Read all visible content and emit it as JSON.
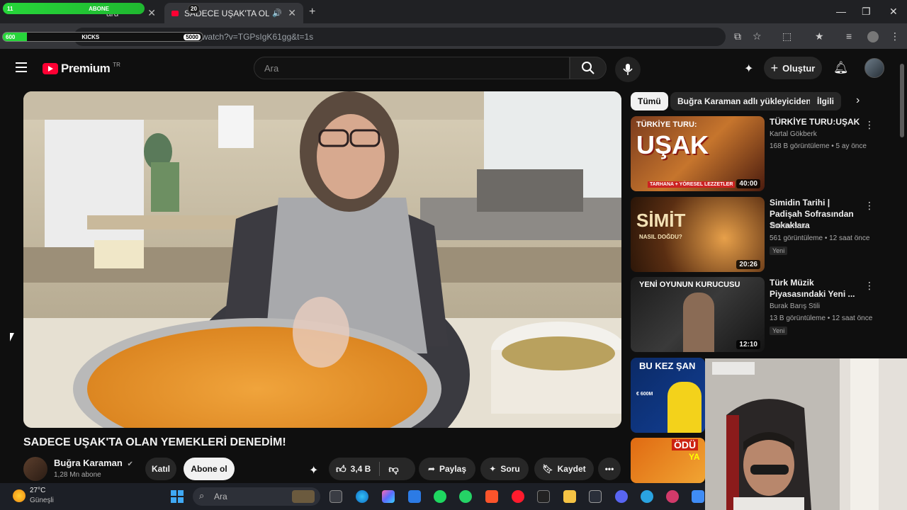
{
  "browser": {
    "tabs": [
      {
        "label": "ard"
      },
      {
        "label": "SADECE UŞAK'TA OLAN YE"
      }
    ],
    "overlay": {
      "left": "11",
      "center": "ABONE",
      "badge": "20"
    },
    "url": "https://www.youtube.com/watch?v=TGPsIgK61gg&t=1s",
    "overlay2": {
      "left": "600",
      "center": "KICKS",
      "right": "5000"
    }
  },
  "youtube": {
    "logo": "Premium",
    "region": "TR",
    "search_placeholder": "Ara",
    "create_label": "Oluştur"
  },
  "video": {
    "title": "SADECE UŞAK'TA OLAN YEMEKLERİ DENEDİM!",
    "channel": "Buğra Karaman",
    "subscribers": "1,28 Mn abone",
    "join_label": "Katıl",
    "subscribe_label": "Abone ol",
    "likes": "3,4 B",
    "share_label": "Paylaş",
    "ask_label": "Soru",
    "save_label": "Kaydet"
  },
  "chips": [
    "Tümü",
    "Buğra Karaman adlı yükleyiciden",
    "İlgili"
  ],
  "recommendations": [
    {
      "title": "TÜRKİYE TURU:UŞAK",
      "channel": "Kartal Gökberk",
      "meta": "168 B görüntüleme • 5 ay önce",
      "duration": "40:00",
      "badge": "",
      "thumb_text": "UŞAK",
      "thumb_top": "TÜRKİYE TURU:",
      "thumb_bottom": "TARHANA + YÖRESEL LEZZETLER"
    },
    {
      "title": "Simidin Tarihi | Padişah Sofrasından Sokaklara",
      "channel": "Tarihin Notu",
      "meta": "561 görüntüleme • 12 saat önce",
      "duration": "20:26",
      "badge": "Yeni",
      "thumb_text": "SİMİT",
      "thumb_top": "",
      "thumb_bottom": "NASIL DOĞDU?"
    },
    {
      "title": "Türk Müzik Piyasasındaki Yeni ...",
      "channel": "Burak Barış Stili",
      "meta": "13 B görüntüleme • 12 saat önce",
      "duration": "12:10",
      "badge": "Yeni",
      "thumb_text": "YENİ OYUNUN KURUCUSU",
      "thumb_top": "",
      "thumb_bottom": ""
    },
    {
      "title": "",
      "channel": "",
      "meta": "",
      "duration": "",
      "badge": "",
      "thumb_text": "BU KEZ ŞAN",
      "thumb_top": "",
      "thumb_bottom": "€ 600M"
    },
    {
      "title": "",
      "channel": "",
      "meta": "",
      "duration": "",
      "badge": "",
      "thumb_text": "ÖDÜ",
      "thumb_top": "",
      "thumb_bottom": "YA"
    }
  ],
  "taskbar": {
    "temp": "27°C",
    "weather": "Güneşli",
    "search": "Ara"
  },
  "colors": {
    "accent": "#ff0033",
    "background": "#0f0f0f",
    "overlay_green": "#27d63a"
  }
}
